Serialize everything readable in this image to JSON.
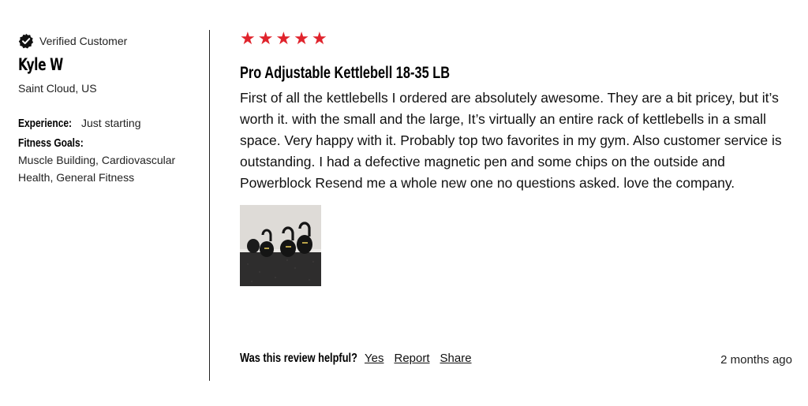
{
  "reviewer": {
    "verified_label": "Verified Customer",
    "name": "Kyle W",
    "location": "Saint Cloud, US",
    "experience_label": "Experience:",
    "experience_value": "Just starting",
    "goals_label": "Fitness Goals:",
    "goals_value": "Muscle Building, Cardiovascular Health, General Fitness"
  },
  "review": {
    "rating": 5,
    "star_glyph": "★",
    "star_color": "#e0232c",
    "title": "Pro Adjustable Kettlebell 18-35 LB",
    "body": "First of all the kettlebells I ordered are absolutely awesome. They are a bit pricey, but it’s worth it. with the small and the large, It’s virtually an entire rack of kettlebells in a small space. Very happy with it. Probably top two favorites in my gym. Also customer service is outstanding. I had a defective magnetic pen and some chips on the outside and Powerblock Resend me a whole new one no questions asked. love the company.",
    "photo_icon": "kettlebells-photo"
  },
  "footer": {
    "helpful_label": "Was this review helpful?",
    "yes_label": "Yes",
    "report_label": "Report",
    "share_label": "Share",
    "timestamp": "2 months ago"
  }
}
